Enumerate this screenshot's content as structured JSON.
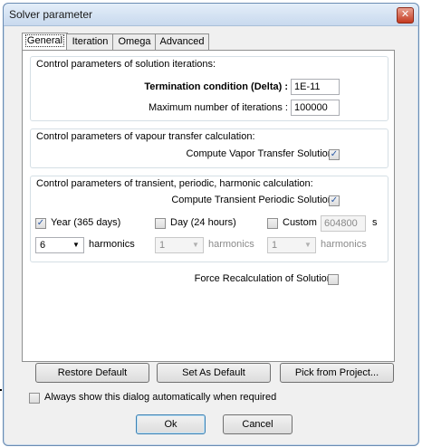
{
  "window": {
    "title": "Solver parameter",
    "close_glyph": "✕"
  },
  "tabs": [
    {
      "label": "General"
    },
    {
      "label": "Iteration"
    },
    {
      "label": "Omega"
    },
    {
      "label": "Advanced"
    }
  ],
  "solution_iterations": {
    "title": "Control parameters of solution iterations:",
    "termination_label": "Termination condition (Delta) :",
    "termination_value": "1E-11",
    "max_iter_label": "Maximum number of iterations :",
    "max_iter_value": "100000"
  },
  "vapour": {
    "title": "Control parameters of vapour transfer calculation:",
    "compute_label": "Compute Vapor Transfer Solution :",
    "compute_checked": true
  },
  "transient": {
    "title": "Control parameters of transient, periodic, harmonic calculation:",
    "compute_label": "Compute Transient Periodic Solution :",
    "compute_checked": true,
    "year_label": "Year (365 days)",
    "year_checked": true,
    "day_label": "Day (24 hours)",
    "day_checked": false,
    "custom_label": "Custom",
    "custom_checked": false,
    "custom_value": "604800",
    "custom_unit": "s",
    "year_harmonics": "6",
    "day_harmonics": "1",
    "custom_harmonics": "1",
    "harmonics_label": "harmonics"
  },
  "force": {
    "label": "Force Recalculation of Solution :",
    "checked": false
  },
  "buttons": {
    "restore": "Restore Default",
    "set_default": "Set As Default",
    "pick": "Pick from Project...",
    "ok": "Ok",
    "cancel": "Cancel"
  },
  "always_show": {
    "label": "Always show this dialog automatically when required",
    "checked": false
  },
  "check_glyph": "✓",
  "arrow_glyph": "▼"
}
